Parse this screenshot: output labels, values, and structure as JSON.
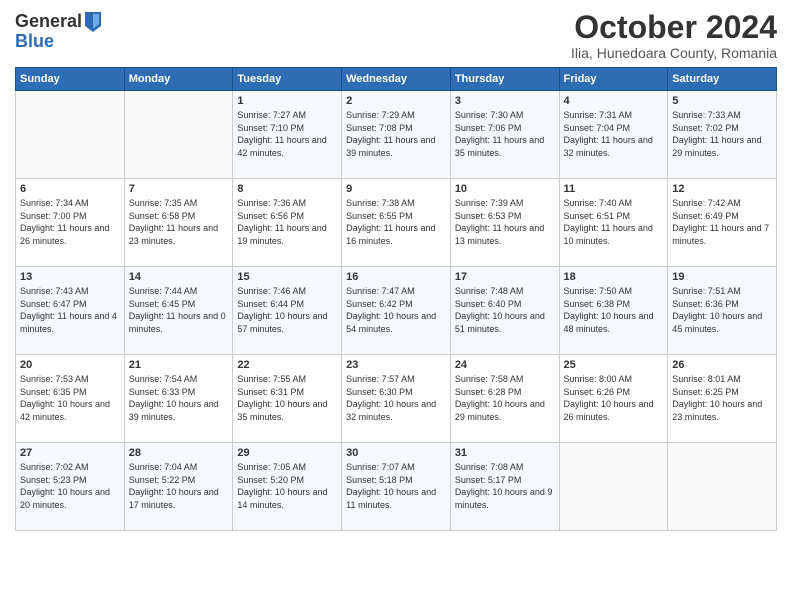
{
  "logo": {
    "general": "General",
    "blue": "Blue"
  },
  "header": {
    "month": "October 2024",
    "location": "Ilia, Hunedoara County, Romania"
  },
  "weekdays": [
    "Sunday",
    "Monday",
    "Tuesday",
    "Wednesday",
    "Thursday",
    "Friday",
    "Saturday"
  ],
  "weeks": [
    [
      {
        "day": "",
        "info": ""
      },
      {
        "day": "",
        "info": ""
      },
      {
        "day": "1",
        "info": "Sunrise: 7:27 AM\nSunset: 7:10 PM\nDaylight: 11 hours and 42 minutes."
      },
      {
        "day": "2",
        "info": "Sunrise: 7:29 AM\nSunset: 7:08 PM\nDaylight: 11 hours and 39 minutes."
      },
      {
        "day": "3",
        "info": "Sunrise: 7:30 AM\nSunset: 7:06 PM\nDaylight: 11 hours and 35 minutes."
      },
      {
        "day": "4",
        "info": "Sunrise: 7:31 AM\nSunset: 7:04 PM\nDaylight: 11 hours and 32 minutes."
      },
      {
        "day": "5",
        "info": "Sunrise: 7:33 AM\nSunset: 7:02 PM\nDaylight: 11 hours and 29 minutes."
      }
    ],
    [
      {
        "day": "6",
        "info": "Sunrise: 7:34 AM\nSunset: 7:00 PM\nDaylight: 11 hours and 26 minutes."
      },
      {
        "day": "7",
        "info": "Sunrise: 7:35 AM\nSunset: 6:58 PM\nDaylight: 11 hours and 23 minutes."
      },
      {
        "day": "8",
        "info": "Sunrise: 7:36 AM\nSunset: 6:56 PM\nDaylight: 11 hours and 19 minutes."
      },
      {
        "day": "9",
        "info": "Sunrise: 7:38 AM\nSunset: 6:55 PM\nDaylight: 11 hours and 16 minutes."
      },
      {
        "day": "10",
        "info": "Sunrise: 7:39 AM\nSunset: 6:53 PM\nDaylight: 11 hours and 13 minutes."
      },
      {
        "day": "11",
        "info": "Sunrise: 7:40 AM\nSunset: 6:51 PM\nDaylight: 11 hours and 10 minutes."
      },
      {
        "day": "12",
        "info": "Sunrise: 7:42 AM\nSunset: 6:49 PM\nDaylight: 11 hours and 7 minutes."
      }
    ],
    [
      {
        "day": "13",
        "info": "Sunrise: 7:43 AM\nSunset: 6:47 PM\nDaylight: 11 hours and 4 minutes."
      },
      {
        "day": "14",
        "info": "Sunrise: 7:44 AM\nSunset: 6:45 PM\nDaylight: 11 hours and 0 minutes."
      },
      {
        "day": "15",
        "info": "Sunrise: 7:46 AM\nSunset: 6:44 PM\nDaylight: 10 hours and 57 minutes."
      },
      {
        "day": "16",
        "info": "Sunrise: 7:47 AM\nSunset: 6:42 PM\nDaylight: 10 hours and 54 minutes."
      },
      {
        "day": "17",
        "info": "Sunrise: 7:48 AM\nSunset: 6:40 PM\nDaylight: 10 hours and 51 minutes."
      },
      {
        "day": "18",
        "info": "Sunrise: 7:50 AM\nSunset: 6:38 PM\nDaylight: 10 hours and 48 minutes."
      },
      {
        "day": "19",
        "info": "Sunrise: 7:51 AM\nSunset: 6:36 PM\nDaylight: 10 hours and 45 minutes."
      }
    ],
    [
      {
        "day": "20",
        "info": "Sunrise: 7:53 AM\nSunset: 6:35 PM\nDaylight: 10 hours and 42 minutes."
      },
      {
        "day": "21",
        "info": "Sunrise: 7:54 AM\nSunset: 6:33 PM\nDaylight: 10 hours and 39 minutes."
      },
      {
        "day": "22",
        "info": "Sunrise: 7:55 AM\nSunset: 6:31 PM\nDaylight: 10 hours and 35 minutes."
      },
      {
        "day": "23",
        "info": "Sunrise: 7:57 AM\nSunset: 6:30 PM\nDaylight: 10 hours and 32 minutes."
      },
      {
        "day": "24",
        "info": "Sunrise: 7:58 AM\nSunset: 6:28 PM\nDaylight: 10 hours and 29 minutes."
      },
      {
        "day": "25",
        "info": "Sunrise: 8:00 AM\nSunset: 6:26 PM\nDaylight: 10 hours and 26 minutes."
      },
      {
        "day": "26",
        "info": "Sunrise: 8:01 AM\nSunset: 6:25 PM\nDaylight: 10 hours and 23 minutes."
      }
    ],
    [
      {
        "day": "27",
        "info": "Sunrise: 7:02 AM\nSunset: 5:23 PM\nDaylight: 10 hours and 20 minutes."
      },
      {
        "day": "28",
        "info": "Sunrise: 7:04 AM\nSunset: 5:22 PM\nDaylight: 10 hours and 17 minutes."
      },
      {
        "day": "29",
        "info": "Sunrise: 7:05 AM\nSunset: 5:20 PM\nDaylight: 10 hours and 14 minutes."
      },
      {
        "day": "30",
        "info": "Sunrise: 7:07 AM\nSunset: 5:18 PM\nDaylight: 10 hours and 11 minutes."
      },
      {
        "day": "31",
        "info": "Sunrise: 7:08 AM\nSunset: 5:17 PM\nDaylight: 10 hours and 9 minutes."
      },
      {
        "day": "",
        "info": ""
      },
      {
        "day": "",
        "info": ""
      }
    ]
  ]
}
